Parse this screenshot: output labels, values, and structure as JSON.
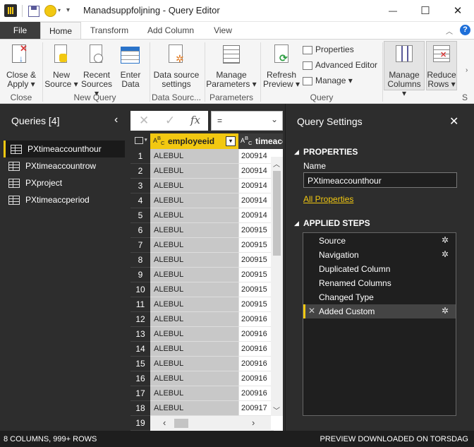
{
  "window": {
    "title": "Manadsuppfoljning - Query Editor",
    "minimize": "—",
    "maximize": "☐",
    "close": "✕"
  },
  "tabs": [
    "File",
    "Home",
    "Transform",
    "Add Column",
    "View"
  ],
  "ribbon": {
    "close_apply": [
      "Close &",
      "Apply ▾"
    ],
    "close_group": "Close",
    "new_source": [
      "New",
      "Source ▾"
    ],
    "recent_sources": [
      "Recent",
      "Sources ▾"
    ],
    "enter_data": [
      "Enter",
      "Data"
    ],
    "new_query_group": "New Query",
    "data_source_settings": [
      "Data source",
      "settings"
    ],
    "data_sources_group": "Data Sourc...",
    "manage_parameters": [
      "Manage",
      "Parameters ▾"
    ],
    "parameters_group": "Parameters",
    "refresh_preview": [
      "Refresh",
      "Preview ▾"
    ],
    "properties": "Properties",
    "advanced_editor": "Advanced Editor",
    "manage": "Manage ▾",
    "query_group": "Query",
    "manage_columns": [
      "Manage",
      "Columns ▾"
    ],
    "reduce_rows": [
      "Reduce",
      "Rows ▾"
    ],
    "more_group": "S"
  },
  "queries": {
    "title": "Queries [4]",
    "items": [
      "PXtimeaccounthour",
      "PXtimeaccountrow",
      "PXproject",
      "PXtimeaccperiod"
    ]
  },
  "formula": {
    "cancel": "✕",
    "commit": "✓",
    "fx": "fx",
    "value": "="
  },
  "grid": {
    "columns": [
      "employeeid",
      "timeacc"
    ],
    "rows": [
      [
        "1",
        "ALEBUL",
        "200914"
      ],
      [
        "2",
        "ALEBUL",
        "200914"
      ],
      [
        "3",
        "ALEBUL",
        "200914"
      ],
      [
        "4",
        "ALEBUL",
        "200914"
      ],
      [
        "5",
        "ALEBUL",
        "200914"
      ],
      [
        "6",
        "ALEBUL",
        "200915"
      ],
      [
        "7",
        "ALEBUL",
        "200915"
      ],
      [
        "8",
        "ALEBUL",
        "200915"
      ],
      [
        "9",
        "ALEBUL",
        "200915"
      ],
      [
        "10",
        "ALEBUL",
        "200915"
      ],
      [
        "11",
        "ALEBUL",
        "200915"
      ],
      [
        "12",
        "ALEBUL",
        "200916"
      ],
      [
        "13",
        "ALEBUL",
        "200916"
      ],
      [
        "14",
        "ALEBUL",
        "200916"
      ],
      [
        "15",
        "ALEBUL",
        "200916"
      ],
      [
        "16",
        "ALEBUL",
        "200916"
      ],
      [
        "17",
        "ALEBUL",
        "200916"
      ],
      [
        "18",
        "ALEBUL",
        "200917"
      ],
      [
        "19",
        "",
        ""
      ]
    ]
  },
  "settings": {
    "title": "Query Settings",
    "properties_header": "PROPERTIES",
    "name_label": "Name",
    "name_value": "PXtimeaccounthour",
    "all_properties": "All Properties",
    "applied_steps_header": "APPLIED STEPS",
    "steps": [
      "Source",
      "Navigation",
      "Duplicated Column",
      "Renamed Columns",
      "Changed Type",
      "Added Custom"
    ]
  },
  "status": {
    "left": "8 COLUMNS, 999+ ROWS",
    "right": "PREVIEW DOWNLOADED ON TORSDAG"
  },
  "colors": {
    "accent": "#f2c811",
    "link": "#f2c811"
  }
}
